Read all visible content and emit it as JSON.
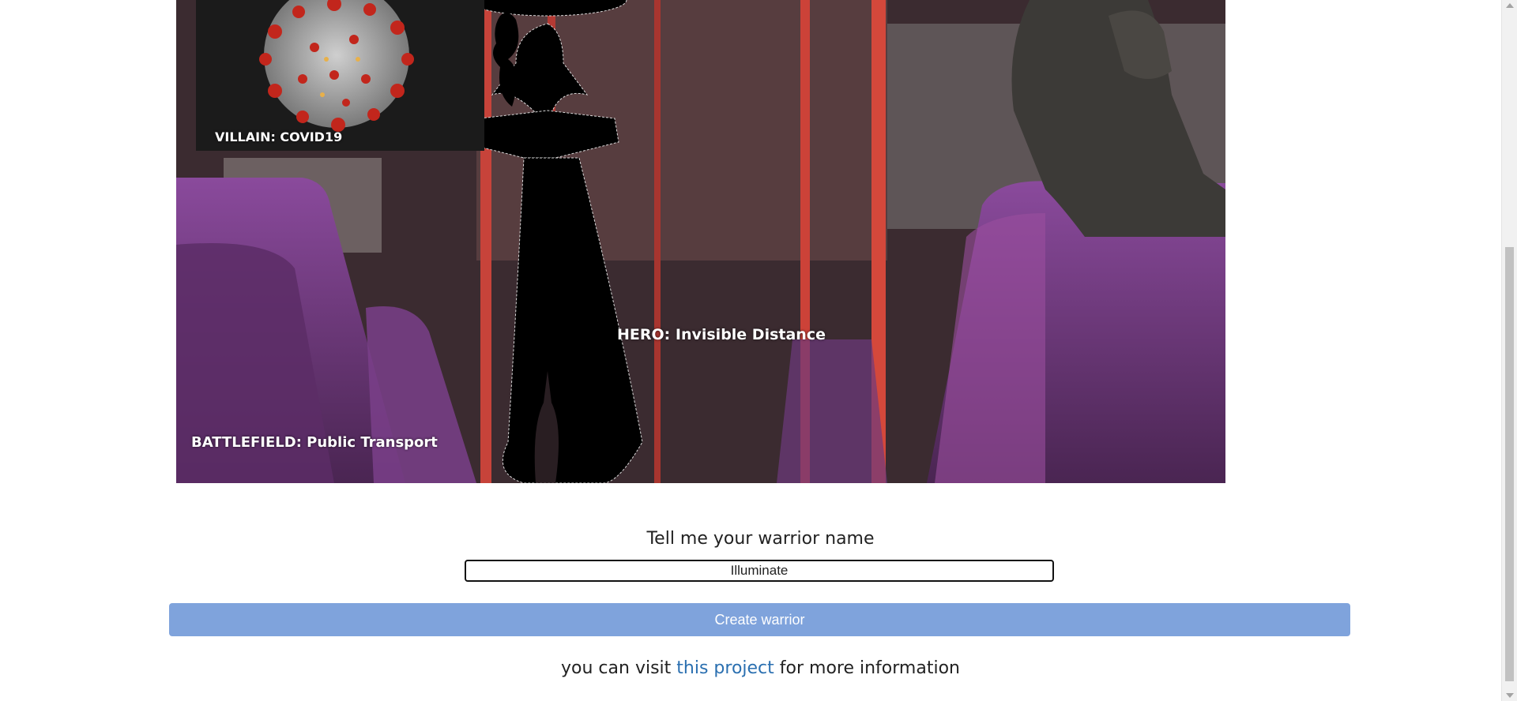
{
  "scene": {
    "villain_label": "VILLAIN: COVID19",
    "hero_label": "HERO: Invisible Distance",
    "battlefield_label": "BATTLEFIELD: Public Transport"
  },
  "form": {
    "prompt": "Tell me your warrior name",
    "name_value": "Illuminate",
    "create_button_label": "Create warrior"
  },
  "footer": {
    "prefix": "you can visit",
    "link_text": "this project",
    "suffix": "for more information"
  },
  "colors": {
    "button_bg": "#7fa3dc",
    "link": "#2a6fb0"
  }
}
